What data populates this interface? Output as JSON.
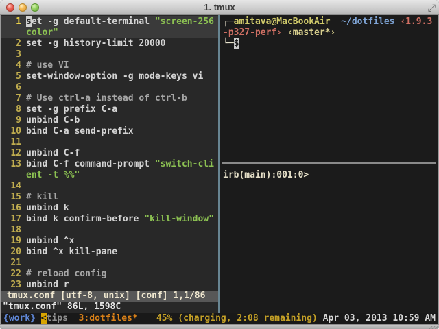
{
  "window": {
    "title": "1. tmux"
  },
  "colors": {
    "vim_bg": "#282828",
    "shell_bg": "#1b1b1b",
    "statusbar_bg": "#191919",
    "string_green": "#8cc152",
    "line_number_yellow": "#c0ad4f",
    "session_blue": "#5f87d7",
    "active_window_orange": "#d98018",
    "battery_yellow": "#c5a126",
    "ruby_red": "#cf6f63",
    "path_blue": "#7fa5d6",
    "user_khaki": "#cfc96a",
    "pane_border": "#74929f"
  },
  "editor": {
    "rows": [
      {
        "num": "1",
        "cursorline": true,
        "segments": [
          {
            "t": "s",
            "c": "cursor"
          },
          {
            "t": "et -g default-terminal ",
            "c": "code"
          },
          {
            "t": "\"screen-256",
            "c": "string"
          }
        ]
      },
      {
        "num": "",
        "cursorline": true,
        "segments": [
          {
            "t": "color\"",
            "c": "string"
          }
        ]
      },
      {
        "num": "2",
        "segments": [
          {
            "t": "set -g history-limit 20000",
            "c": "code"
          }
        ]
      },
      {
        "num": "3",
        "segments": []
      },
      {
        "num": "4",
        "segments": [
          {
            "t": "# use VI",
            "c": "comment"
          }
        ]
      },
      {
        "num": "5",
        "segments": [
          {
            "t": "set-window-option -g mode-keys vi",
            "c": "code"
          }
        ]
      },
      {
        "num": "6",
        "segments": []
      },
      {
        "num": "7",
        "segments": [
          {
            "t": "# Use ctrl-a instead of ctrl-b",
            "c": "comment"
          }
        ]
      },
      {
        "num": "8",
        "segments": [
          {
            "t": "set -g prefix C-a",
            "c": "code"
          }
        ]
      },
      {
        "num": "9",
        "segments": [
          {
            "t": "unbind C-b",
            "c": "code"
          }
        ]
      },
      {
        "num": "10",
        "segments": [
          {
            "t": "bind C-a send-prefix",
            "c": "code"
          }
        ]
      },
      {
        "num": "11",
        "segments": []
      },
      {
        "num": "12",
        "segments": [
          {
            "t": "unbind C-f",
            "c": "code"
          }
        ]
      },
      {
        "num": "13",
        "segments": [
          {
            "t": "bind C-f command-prompt ",
            "c": "code"
          },
          {
            "t": "\"switch-cli",
            "c": "string"
          }
        ]
      },
      {
        "num": "",
        "segments": [
          {
            "t": "ent -t %%\"",
            "c": "string"
          }
        ]
      },
      {
        "num": "14",
        "segments": []
      },
      {
        "num": "15",
        "segments": [
          {
            "t": "# kill",
            "c": "comment"
          }
        ]
      },
      {
        "num": "16",
        "segments": [
          {
            "t": "unbind k",
            "c": "code"
          }
        ]
      },
      {
        "num": "17",
        "segments": [
          {
            "t": "bind k confirm-before ",
            "c": "code"
          },
          {
            "t": "\"kill-window\"",
            "c": "string"
          }
        ]
      },
      {
        "num": "18",
        "segments": []
      },
      {
        "num": "19",
        "segments": [
          {
            "t": "unbind ^x",
            "c": "code"
          }
        ]
      },
      {
        "num": "20",
        "segments": [
          {
            "t": "bind ^x kill-pane",
            "c": "code"
          }
        ]
      },
      {
        "num": "21",
        "segments": []
      },
      {
        "num": "22",
        "segments": [
          {
            "t": "# reload config",
            "c": "comment"
          }
        ]
      },
      {
        "num": "23",
        "segments": [
          {
            "t": "unbind r",
            "c": "code"
          }
        ]
      }
    ],
    "statusline": " tmux.conf [utf-8, unix] [conf] 1,1/86",
    "message": "\"tmux.conf\" 86L, 1598C"
  },
  "shell": {
    "lines": [
      [
        {
          "t": "┌─",
          "c": "frame"
        },
        {
          "t": "amitava@MacBookAir",
          "c": "user"
        },
        {
          "t": "  ",
          "c": "frame"
        },
        {
          "t": "~/dotfiles",
          "c": "path"
        },
        {
          "t": " ",
          "c": "frame"
        },
        {
          "t": "‹1.9.3",
          "c": "ruby"
        }
      ],
      [
        {
          "t": "-p327-perf›",
          "c": "ruby"
        },
        {
          "t": " ",
          "c": "frame"
        },
        {
          "t": "‹master*›",
          "c": "branch"
        }
      ],
      [
        {
          "t": "└─",
          "c": "frame"
        },
        {
          "t": "$",
          "c": "shellcursor"
        }
      ]
    ]
  },
  "irb": {
    "prompt_segments": [
      [
        {
          "t": "irb(main):001:0>",
          "c": "irb"
        }
      ]
    ]
  },
  "statusbar": {
    "left": [
      {
        "t": "{work} ",
        "c": "session"
      },
      {
        "t": "<",
        "c": "trunc"
      },
      {
        "t": "tips",
        "c": "win-inactive"
      },
      {
        "t": "  ",
        "c": "plain"
      },
      {
        "t": "3:dotfiles*",
        "c": "win-active"
      }
    ],
    "right": [
      {
        "t": "45% (charging, 2:08 remaining)",
        "c": "battery"
      },
      {
        "t": " ",
        "c": "plain"
      },
      {
        "t": "Apr 03, 2013 10:59 AM",
        "c": "clock"
      }
    ]
  }
}
